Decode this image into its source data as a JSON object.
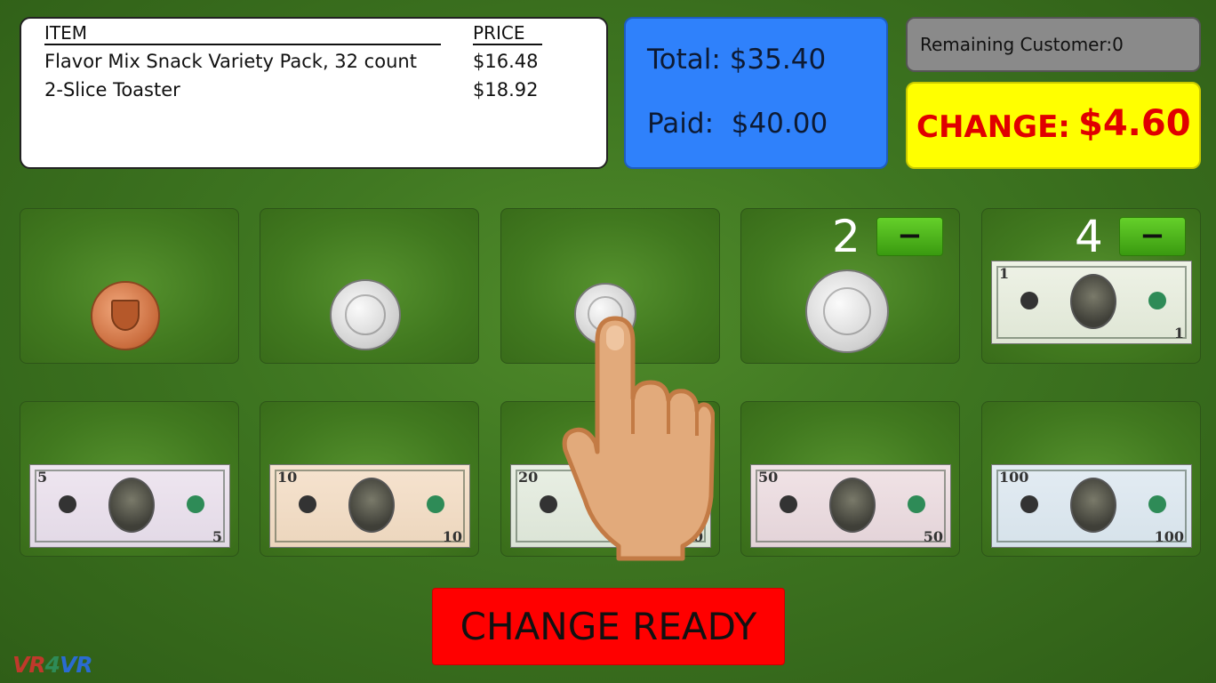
{
  "receipt": {
    "header_item": "ITEM",
    "header_price": "PRICE",
    "items": [
      {
        "name": "Flavor Mix Snack Variety Pack, 32 count",
        "price": "$16.48"
      },
      {
        "name": "2-Slice Toaster",
        "price": "$18.92"
      }
    ]
  },
  "totals": {
    "total_line": "Total: $35.40",
    "paid_line": "Paid:  $40.00"
  },
  "status": {
    "remaining": "Remaining Customer:0",
    "change_label": "CHANGE:",
    "change_amount": "$4.60"
  },
  "tray": {
    "penny": {
      "icon": "penny-coin-icon"
    },
    "nickel": {
      "icon": "nickel-coin-icon"
    },
    "dime": {
      "icon": "dime-coin-icon"
    },
    "quarter": {
      "icon": "quarter-coin-icon",
      "count": "2",
      "minus": "−"
    },
    "one": {
      "icon": "one-dollar-bill-icon",
      "count": "4",
      "minus": "−",
      "den": "1"
    },
    "five": {
      "icon": "five-dollar-bill-icon",
      "den": "5"
    },
    "ten": {
      "icon": "ten-dollar-bill-icon",
      "den": "10"
    },
    "twenty": {
      "icon": "twenty-dollar-bill-icon",
      "den": "20"
    },
    "fifty": {
      "icon": "fifty-dollar-bill-icon",
      "den": "50"
    },
    "hundred": {
      "icon": "hundred-dollar-bill-icon",
      "den": "100"
    }
  },
  "actions": {
    "change_ready": "CHANGE READY"
  },
  "logo": {
    "part1": "VR",
    "part2": "4",
    "part3": "VR"
  },
  "colors": {
    "background": "#3d7420",
    "totals_panel": "#2f81fb",
    "change_panel": "#ffff00",
    "change_text": "#e00000",
    "change_ready_button": "#ff0000",
    "remaining_panel": "#8a8a8a"
  }
}
